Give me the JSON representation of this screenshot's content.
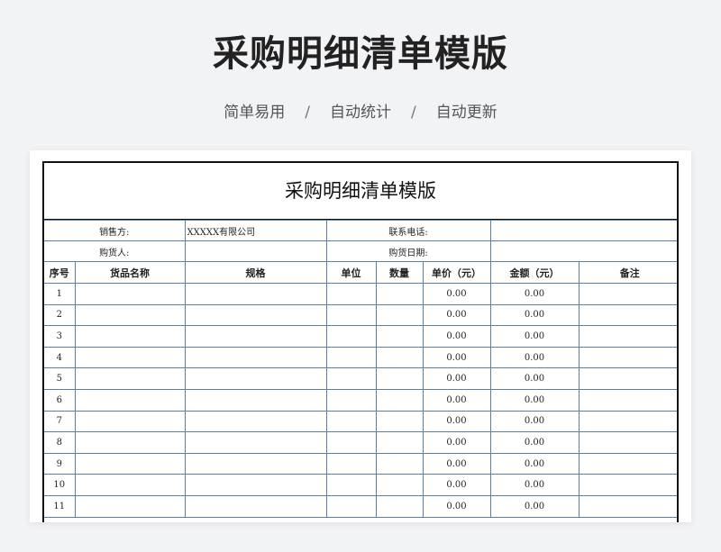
{
  "header": {
    "title": "采购明细清单模版",
    "features": [
      "简单易用",
      "自动统计",
      "自动更新"
    ],
    "separator": "/"
  },
  "sheet": {
    "title": "采购明细清单模版",
    "info": {
      "seller_label": "销售方:",
      "seller_value": "XXXXX有限公司",
      "contact_label": "联系电话:",
      "contact_value": "",
      "buyer_label": "购货人:",
      "buyer_value": "",
      "date_label": "购货日期:",
      "date_value": ""
    },
    "columns": [
      "序号",
      "货品名称",
      "规格",
      "单位",
      "数量",
      "单价（元）",
      "金额（元）",
      "备注"
    ],
    "rows": [
      {
        "no": "1",
        "unit_price": "0.00",
        "amount": "0.00"
      },
      {
        "no": "2",
        "unit_price": "0.00",
        "amount": "0.00"
      },
      {
        "no": "3",
        "unit_price": "0.00",
        "amount": "0.00"
      },
      {
        "no": "4",
        "unit_price": "0.00",
        "amount": "0.00"
      },
      {
        "no": "5",
        "unit_price": "0.00",
        "amount": "0.00"
      },
      {
        "no": "6",
        "unit_price": "0.00",
        "amount": "0.00"
      },
      {
        "no": "7",
        "unit_price": "0.00",
        "amount": "0.00"
      },
      {
        "no": "8",
        "unit_price": "0.00",
        "amount": "0.00"
      },
      {
        "no": "9",
        "unit_price": "0.00",
        "amount": "0.00"
      },
      {
        "no": "10",
        "unit_price": "0.00",
        "amount": "0.00"
      },
      {
        "no": "11",
        "unit_price": "0.00",
        "amount": "0.00"
      }
    ]
  },
  "colors": {
    "background": "#f2f3f5",
    "grid": "#5b7fa3",
    "border": "#111111"
  }
}
